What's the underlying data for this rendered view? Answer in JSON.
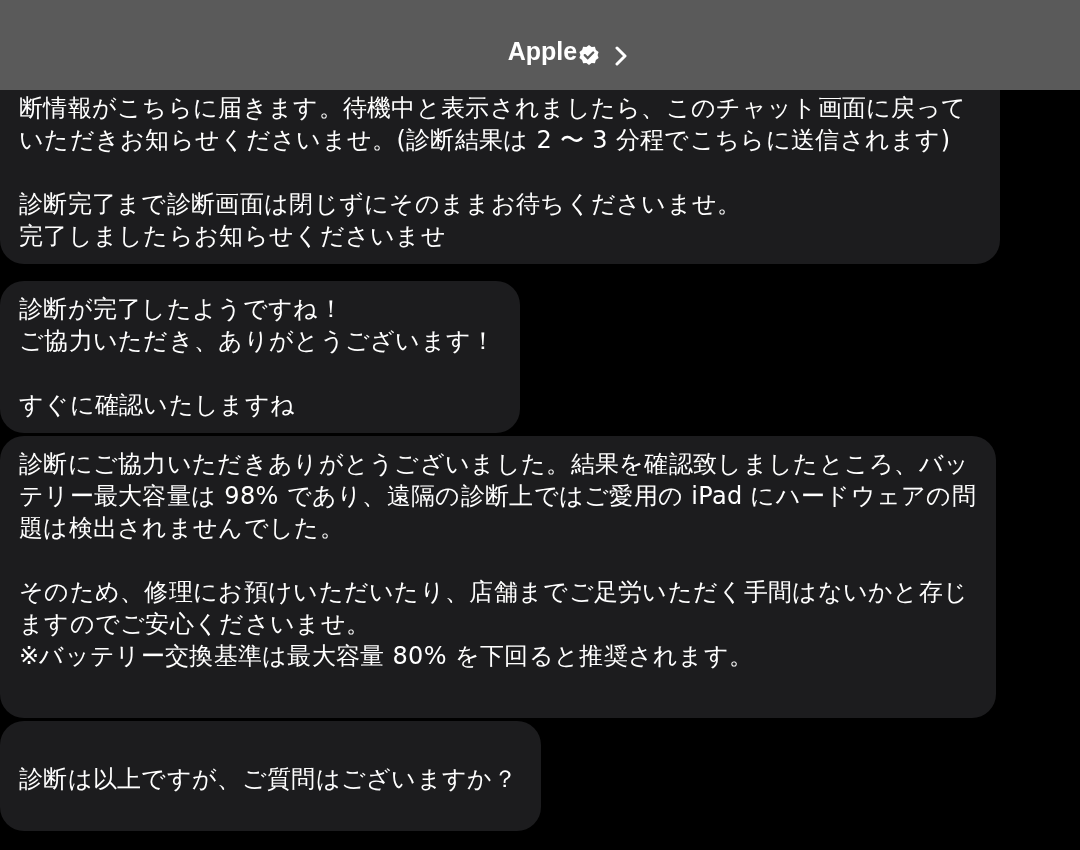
{
  "header": {
    "title": "Apple",
    "verified": true
  },
  "messages": [
    {
      "paragraphs": [
        [
          "断情報がこちらに届きます。待機中と表示されましたら、このチャット画面に戻って",
          "いただきお知らせくださいませ。(診断結果は 2 〜 3 分程でこちらに送信されます)"
        ],
        [
          "診断完了まで診断画面は閉じずにそのままお待ちくださいませ。",
          "完了しましたらお知らせくださいませ"
        ]
      ]
    },
    {
      "paragraphs": [
        [
          "診断が完了したようですね！",
          "ご協力いただき、ありがとうございます！"
        ],
        [
          "すぐに確認いたしますね"
        ]
      ]
    },
    {
      "paragraphs": [
        [
          "診断にご協力いただきありがとうございました。結果を確認致しましたところ、バッ",
          "テリー最大容量は 98% であり、遠隔の診断上ではご愛用の iPad にハードウェアの問",
          "題は検出されませんでした。"
        ],
        [
          "そのため、修理にお預けいただいたり、店舗までご足労いただく手間はないかと存じ",
          "ますのでご安心くださいませ。",
          "※バッテリー交換基準は最大容量 80% を下回ると推奨されます。"
        ]
      ]
    },
    {
      "paragraphs": [
        [
          "診断は以上ですが、ご質問はございますか？"
        ]
      ]
    }
  ]
}
